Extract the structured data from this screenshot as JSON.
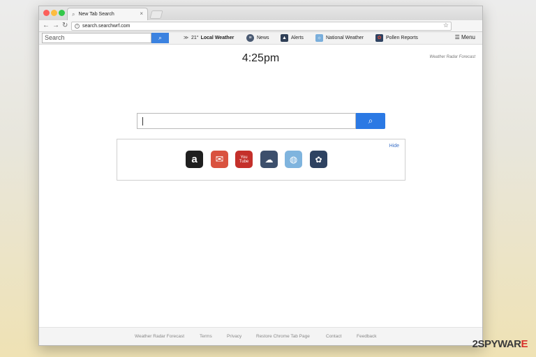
{
  "browser": {
    "tab_title": "New Tab Search",
    "url": "search.searchwrf.com"
  },
  "toolbar": {
    "search_placeholder": "Search",
    "weather_temp": "21°",
    "weather_label": "Local Weather",
    "news_label": "News",
    "alerts_label": "Alerts",
    "national_weather_label": "National Weather",
    "pollen_label": "Pollen Reports",
    "menu_label": "Menu"
  },
  "main": {
    "time": "4:25pm",
    "radar_link": "Weather Radar Forecast",
    "hide_label": "Hide",
    "shortcuts": [
      {
        "icon": "amazon-icon",
        "glyph": "a"
      },
      {
        "icon": "mail-icon",
        "glyph": "✉"
      },
      {
        "icon": "youtube-icon",
        "glyph": "You Tube"
      },
      {
        "icon": "weather-icon",
        "glyph": "☁"
      },
      {
        "icon": "globe-icon",
        "glyph": "◍"
      },
      {
        "icon": "flower-icon",
        "glyph": "✿"
      }
    ]
  },
  "footer": {
    "links": [
      "Weather Radar Forecast",
      "Terms",
      "Privacy",
      "Restore Chrome Tab Page",
      "Contact",
      "Feedback"
    ]
  },
  "watermark": {
    "part1": "2SPYWAR",
    "part2": "E"
  },
  "colors": {
    "accent": "#2b79e4",
    "link": "#3a6fc6"
  }
}
